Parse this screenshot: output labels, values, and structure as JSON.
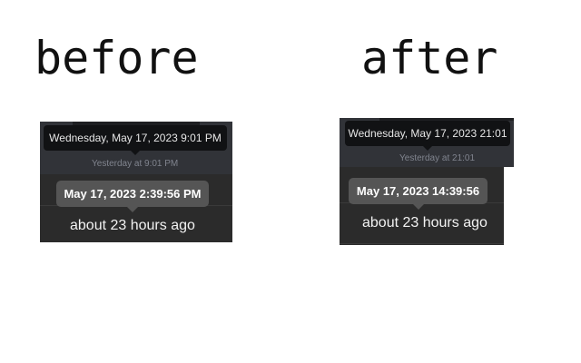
{
  "before": {
    "heading": "before",
    "tooltip_full": "Wednesday, May 17, 2023 9:01 PM",
    "subtext": "Yesterday at 9:01 PM",
    "tooltip_timestamp": "May 17, 2023 2:39:56 PM",
    "relative": "about 23 hours ago"
  },
  "after": {
    "heading": "after",
    "tooltip_full": "Wednesday, May 17, 2023 21:01",
    "subtext": "Yesterday at 21:01",
    "tooltip_timestamp": "May 17, 2023 14:39:56",
    "relative": "about 23 hours ago"
  }
}
